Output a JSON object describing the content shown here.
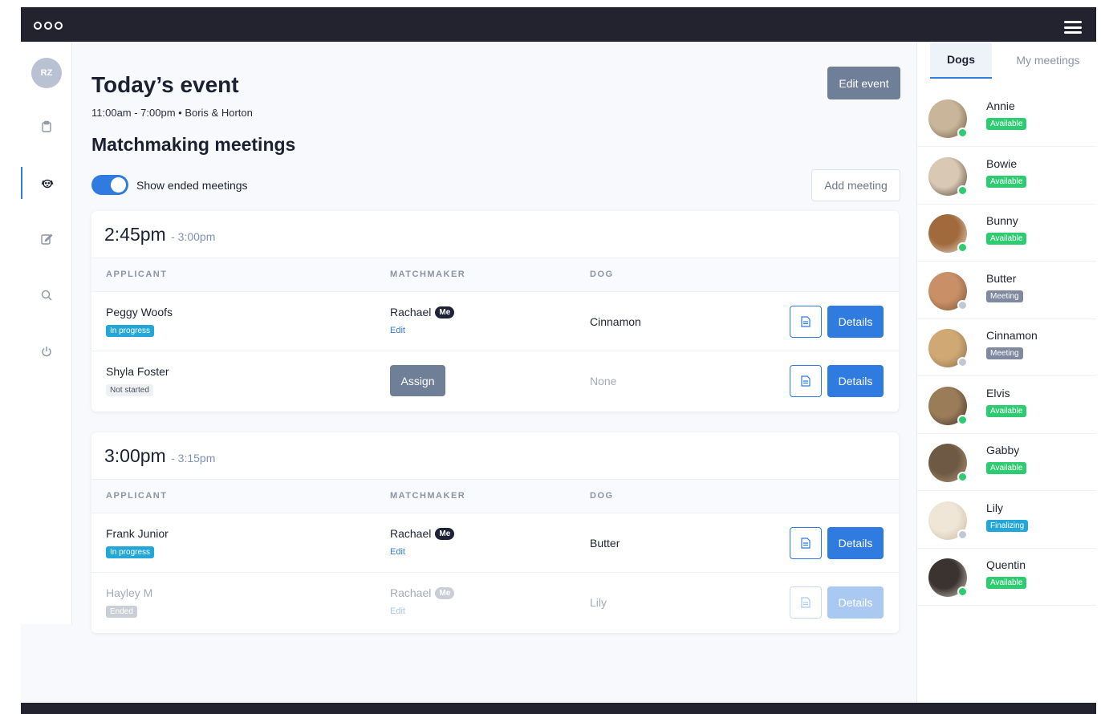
{
  "window": {
    "dots_count": 3
  },
  "sidebar": {
    "avatar_initials": "RZ",
    "items": [
      {
        "name": "clipboard-icon"
      },
      {
        "name": "dog-icon",
        "active": true
      },
      {
        "name": "edit-icon"
      },
      {
        "name": "search-icon"
      },
      {
        "name": "power-icon"
      }
    ]
  },
  "header": {
    "title": "Today’s event",
    "subtitle": "11:00am - 7:00pm • Boris & Horton",
    "edit_event_label": "Edit event"
  },
  "meetings_section": {
    "title": "Matchmaking meetings",
    "toggle_label": "Show ended meetings",
    "toggle_on": true,
    "add_meeting_label": "Add meeting",
    "columns": [
      "APPLICANT",
      "MATCHMAKER",
      "DOG"
    ],
    "slots": [
      {
        "start": "2:45pm",
        "end": "- 3:00pm",
        "rows": [
          {
            "applicant": "Peggy Woofs",
            "status": "In progress",
            "matchmaker": "Rachael",
            "me": "Me",
            "edit": "Edit",
            "dog": "Cinnamon",
            "details": "Details"
          },
          {
            "applicant": "Shyla Foster",
            "status": "Not started",
            "assign": "Assign",
            "dog": "None",
            "details": "Details"
          }
        ]
      },
      {
        "start": "3:00pm",
        "end": "- 3:15pm",
        "rows": [
          {
            "applicant": "Frank Junior",
            "status": "In progress",
            "matchmaker": "Rachael",
            "me": "Me",
            "edit": "Edit",
            "dog": "Butter",
            "details": "Details"
          },
          {
            "applicant": "Hayley M",
            "status": "Ended",
            "matchmaker": "Rachael",
            "me": "Me",
            "edit": "Edit",
            "dog": "Lily",
            "details": "Details"
          }
        ]
      }
    ]
  },
  "right_panel": {
    "tabs": [
      "Dogs",
      "My meetings"
    ],
    "active_tab": "Dogs",
    "dogs": [
      {
        "name": "Annie",
        "status": "Available",
        "online": true
      },
      {
        "name": "Bowie",
        "status": "Available",
        "online": true
      },
      {
        "name": "Bunny",
        "status": "Available",
        "online": true
      },
      {
        "name": "Butter",
        "status": "Meeting",
        "online": false
      },
      {
        "name": "Cinnamon",
        "status": "Meeting",
        "online": false
      },
      {
        "name": "Elvis",
        "status": "Available",
        "online": true
      },
      {
        "name": "Gabby",
        "status": "Available",
        "online": true
      },
      {
        "name": "Lily",
        "status": "Finalizing",
        "online": false
      },
      {
        "name": "Quentin",
        "status": "Available",
        "online": true
      }
    ]
  },
  "colors": {
    "accent": "#2f7be0",
    "available": "#2ecc71",
    "meeting": "#7f8aa0",
    "finalizing": "#23a7d8",
    "in_progress": "#23a7d8",
    "titlebar": "#23232f"
  }
}
